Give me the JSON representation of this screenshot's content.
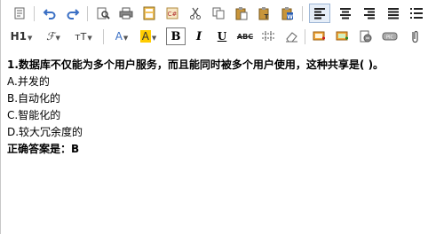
{
  "toolbar": {
    "heading_label": "H1",
    "fontfamily_label": "ℱ",
    "fontsize_label": "тT",
    "bold_label": "B",
    "italic_label": "I",
    "underline_label": "U",
    "strike_label": "ABC",
    "textcolor_label": "A",
    "bgcolor_label": "A",
    "colors": {
      "accent_blue": "#3a6fc4",
      "highlight_yellow": "#ffcc00",
      "toolbar_red": "#cc3333"
    }
  },
  "question": {
    "stem": "1.数据库不仅能为多个用户服务，而且能同时被多个用户使用，这种共享是(  )。",
    "options": [
      {
        "label": "A.并发的"
      },
      {
        "label": "B.自动化的"
      },
      {
        "label": "C.智能化的"
      },
      {
        "label": "D.较大冗余度的"
      }
    ],
    "answer_text": "正确答案是：B"
  }
}
